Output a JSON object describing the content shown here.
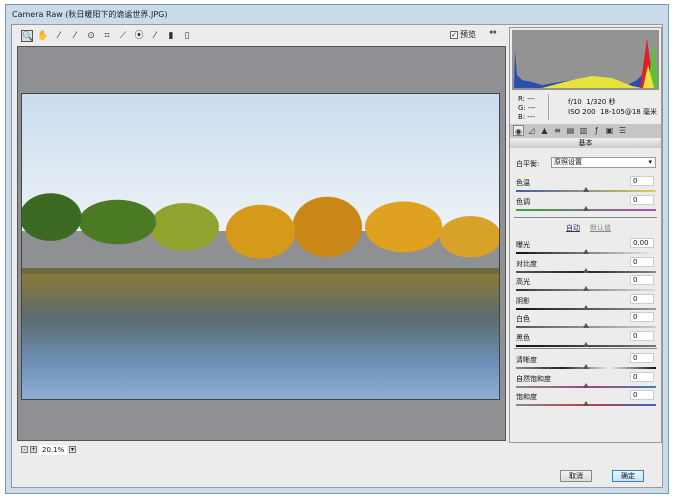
{
  "window": {
    "title": "Camera Raw (秋日暖阳下的诡谧世界.JPG)"
  },
  "toolbar": {
    "tools": [
      "zoom-icon",
      "hand-icon",
      "eyedropper-icon",
      "color-sampler-icon",
      "target-adjust-icon",
      "crop-icon",
      "straighten-icon",
      "spot-removal-icon",
      "red-eye-icon",
      "brush-icon",
      "graduated-filter-icon"
    ],
    "preview_label": "预览",
    "preview_checked": true
  },
  "info": {
    "r": "R: ---",
    "g": "G: ---",
    "b": "B: ---",
    "aperture": "f/10",
    "shutter": "1/320 秒",
    "iso": "ISO 200",
    "lens": "18-105@18 毫米"
  },
  "panel": {
    "section_title": "基本",
    "white_balance": {
      "label": "白平衡:",
      "value": "原照设置"
    },
    "temp": {
      "label": "色温",
      "value": "0"
    },
    "tint": {
      "label": "色调",
      "value": "0"
    },
    "auto": "自动",
    "default": "默认值",
    "tone": [
      {
        "label": "曝光",
        "value": "0.00"
      },
      {
        "label": "对比度",
        "value": "0"
      },
      {
        "label": "高光",
        "value": "0"
      },
      {
        "label": "阴影",
        "value": "0"
      },
      {
        "label": "白色",
        "value": "0"
      },
      {
        "label": "黑色",
        "value": "0"
      }
    ],
    "presence": [
      {
        "label": "清晰度",
        "value": "0"
      },
      {
        "label": "自然饱和度",
        "value": "0"
      },
      {
        "label": "饱和度",
        "value": "0"
      }
    ]
  },
  "zoom": {
    "value": "20.1%"
  },
  "buttons": {
    "cancel": "取消",
    "ok": "确定"
  }
}
